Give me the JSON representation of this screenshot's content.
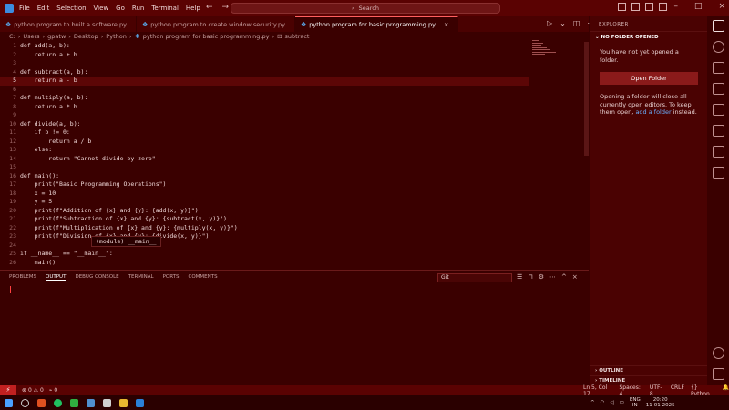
{
  "menu": [
    "File",
    "Edit",
    "Selection",
    "View",
    "Go",
    "Run",
    "Terminal",
    "Help"
  ],
  "search": {
    "label": "Search"
  },
  "tabs": [
    {
      "label": "python program to built a software.py"
    },
    {
      "label": "python program to create window security.py"
    },
    {
      "label": "python program for basic programming.py"
    }
  ],
  "breadcrumb": [
    "C:",
    "Users",
    "gpatw",
    "Desktop",
    "Python",
    "python program for basic programming.py",
    "subtract"
  ],
  "code_lines": [
    "def add(a, b):",
    "    return a + b",
    "",
    "def subtract(a, b):",
    "    return a - b",
    "",
    "def multiply(a, b):",
    "    return a * b",
    "",
    "def divide(a, b):",
    "    if b != 0:",
    "        return a / b",
    "    else:",
    "        return \"Cannot divide by zero\"",
    "",
    "def main():",
    "    print(\"Basic Programming Operations\")",
    "    x = 10",
    "    y = 5",
    "    print(f\"Addition of {x} and {y}: {add(x, y)}\")",
    "    print(f\"Subtraction of {x} and {y}: {subtract(x, y)}\")",
    "    print(f\"Multiplication of {x} and {y}: {multiply(x, y)}\")",
    "    print(f\"Division of {x} and {y}: {divide(x, y)}\")",
    "",
    "if __name__ == \"__main__\":",
    "    main()"
  ],
  "hover_tip": "(module) __main__",
  "panel": {
    "tabs": [
      "PROBLEMS",
      "OUTPUT",
      "DEBUG CONSOLE",
      "TERMINAL",
      "PORTS",
      "COMMENTS"
    ],
    "output_channel": "Git"
  },
  "explorer": {
    "title": "EXPLORER",
    "section": "NO FOLDER OPENED",
    "msg1": "You have not yet opened a folder.",
    "button": "Open Folder",
    "msg2_pre": "Opening a folder will close all currently open editors. To keep them open,",
    "msg2_link": "add a folder",
    "msg2_post": "instead.",
    "outline": "OUTLINE",
    "timeline": "TIMELINE"
  },
  "status": {
    "errors": "0",
    "warnings": "0",
    "ports": "0",
    "position": "Ln 5, Col 17",
    "spaces": "Spaces: 4",
    "encoding": "UTF-8",
    "eol": "CRLF",
    "language": "Python"
  },
  "taskbar": {
    "lang1": "ENG",
    "lang2": "IN",
    "time": "20:20",
    "date": "11-01-2025"
  },
  "colors": {
    "accent": "#c02020",
    "background": "#3a0000",
    "link": "#6ab0ff"
  }
}
